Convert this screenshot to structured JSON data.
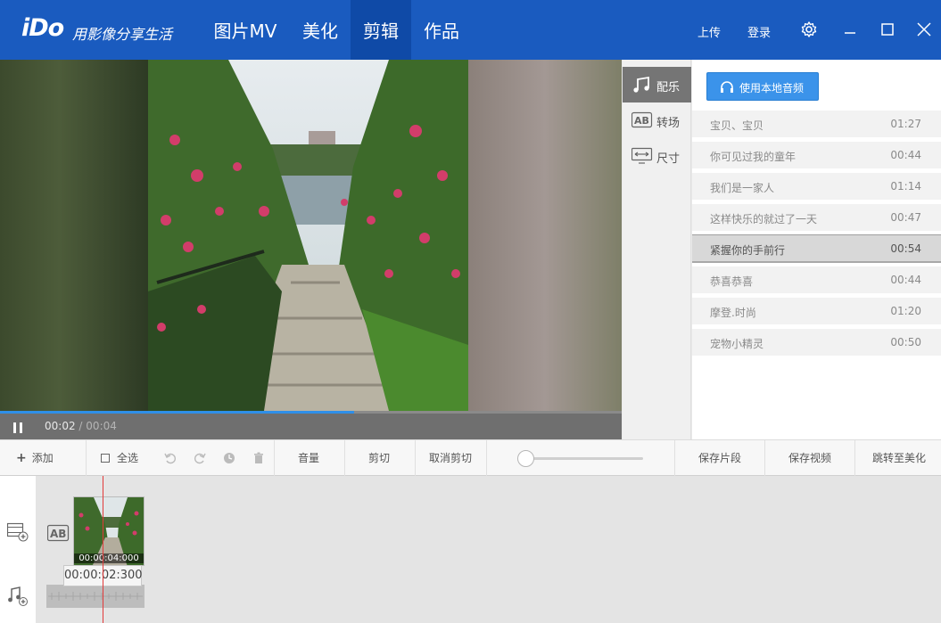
{
  "app": {
    "logo": "iDo",
    "slogan": "用影像分享生活"
  },
  "nav": {
    "tabs": [
      {
        "label": "图片MV"
      },
      {
        "label": "美化"
      },
      {
        "label": "剪辑",
        "active": true
      },
      {
        "label": "作品"
      }
    ],
    "upload": "上传",
    "login": "登录"
  },
  "player": {
    "current_time": "00:02",
    "separator": "/",
    "total_time": "00:04",
    "progress_fraction": 0.57
  },
  "side_tabs": [
    {
      "label": "配乐",
      "icon": "music-note-icon",
      "active": true
    },
    {
      "label": "转场",
      "icon": "ab-transition-icon"
    },
    {
      "label": "尺寸",
      "icon": "screen-size-icon"
    }
  ],
  "music": {
    "local_button": "使用本地音频",
    "tracks": [
      {
        "name": "宝贝、宝贝",
        "duration": "01:27"
      },
      {
        "name": "你可见过我的童年",
        "duration": "00:44"
      },
      {
        "name": "我们是一家人",
        "duration": "01:14"
      },
      {
        "name": "这样快乐的就过了一天",
        "duration": "00:47"
      },
      {
        "name": "紧握你的手前行",
        "duration": "00:54",
        "selected": true
      },
      {
        "name": "恭喜恭喜",
        "duration": "00:44"
      },
      {
        "name": "摩登.时尚",
        "duration": "01:20"
      },
      {
        "name": "宠物小精灵",
        "duration": "00:50"
      }
    ]
  },
  "toolbar": {
    "add": "添加",
    "select_all": "全选",
    "volume": "音量",
    "cut": "剪切",
    "cancel_cut": "取消剪切",
    "save_segment": "保存片段",
    "save_video": "保存视频",
    "goto_beautify": "跳转至美化"
  },
  "timeline": {
    "clip_duration": "00:00:04:000",
    "playhead_time": "00:00:02:300"
  },
  "colors": {
    "titlebar": "#1a5bbf",
    "active_tab": "#0f4aa7",
    "accent_button": "#3b93ea",
    "progress": "#2f8fe8",
    "playhead": "#e23a3a"
  }
}
